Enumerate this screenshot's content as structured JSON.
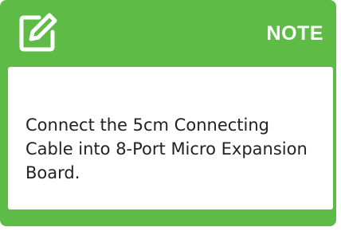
{
  "note": {
    "title": "NOTE",
    "icon": "edit-note-icon",
    "text": "Connect the 5cm Connecting Cable into 8-Port Micro Expansion Board."
  },
  "colors": {
    "accent": "#5dbb46",
    "body_background": "#ffffff",
    "text": "#222222",
    "title_text": "#ffffff"
  }
}
